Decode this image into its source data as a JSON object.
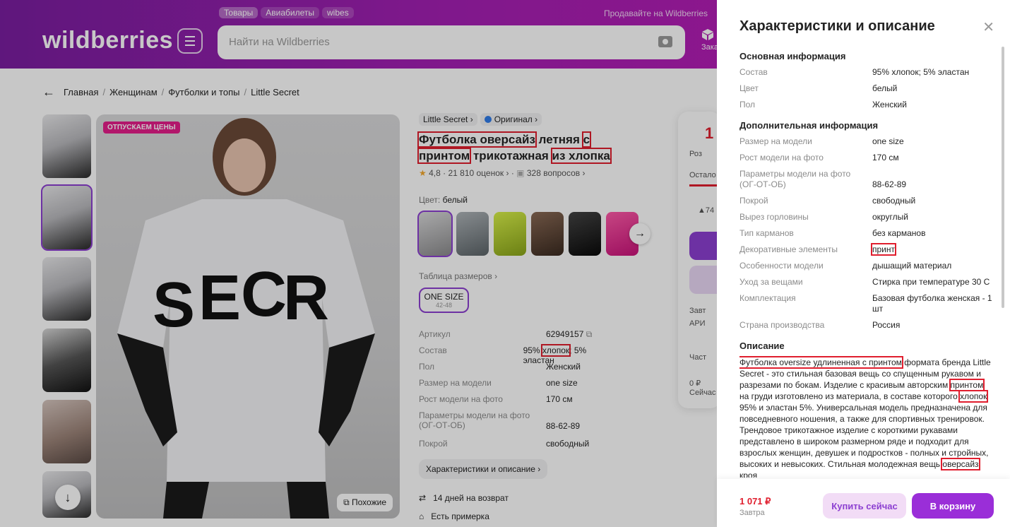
{
  "header": {
    "tabs": [
      "Товары",
      "Авиабилеты",
      "wibes"
    ],
    "sell_link": "Продавайте на Wildberries",
    "logo": "wildberries",
    "search_placeholder": "Найти на Wildberries",
    "orders_short": "Заказ"
  },
  "breadcrumbs": [
    "Главная",
    "Женщинам",
    "Футболки и топы",
    "Little Secret"
  ],
  "gallery": {
    "badge": "ОТПУСКАЕМ ЦЕНЫ",
    "similar": "Похожие"
  },
  "product": {
    "brand": "Little Secret",
    "original": "Оригинал",
    "title_parts": [
      "Футболка оверсайз",
      " летняя ",
      "с принтом",
      " трикотажная ",
      "из хлопка"
    ],
    "rating": "4,8",
    "reviews": "21 810 оценок",
    "questions": "328 вопросов",
    "color_label": "Цвет:",
    "color_value": "белый",
    "size_table": "Таблица размеров",
    "size_label": "ONE SIZE",
    "size_range": "42-48",
    "specs": [
      {
        "k": "Артикул",
        "v": "62949157"
      },
      {
        "k": "Состав",
        "v_parts": [
          "95% ",
          "хлопок",
          "; 5% эластан"
        ]
      },
      {
        "k": "Пол",
        "v": "Женский"
      },
      {
        "k": "Размер на модели",
        "v": "one size"
      },
      {
        "k": "Рост модели на фото",
        "v": "170 см"
      },
      {
        "k": "Параметры модели на фото (ОГ-ОТ-ОБ)",
        "v": "88-62-89"
      },
      {
        "k": "Покрой",
        "v": "свободный"
      }
    ],
    "char_button": "Характеристики и описание",
    "return": "14 дней на возврат",
    "fitting": "Есть примерка"
  },
  "buycard": {
    "price_partial": "1",
    "stock_partial": "Остало",
    "tag_partial": "Роз",
    "qty_partial": "▲74",
    "delivery_partial": "Завт",
    "ari_partial": "АРИ",
    "part_partial": "Част",
    "zero": "0 ₽",
    "now": "Сейчас"
  },
  "panel": {
    "title": "Характеристики и описание",
    "sections": [
      {
        "title": "Основная информация",
        "rows": [
          {
            "k": "Состав",
            "v": "95% хлопок; 5% эластан"
          },
          {
            "k": "Цвет",
            "v": "белый"
          },
          {
            "k": "Пол",
            "v": "Женский"
          }
        ]
      },
      {
        "title": "Дополнительная информация",
        "rows": [
          {
            "k": "Размер на модели",
            "v": "one size"
          },
          {
            "k": "Рост модели на фото",
            "v": "170 см"
          },
          {
            "k": "Параметры модели на фото (ОГ-ОТ-ОБ)",
            "v": "88-62-89"
          },
          {
            "k": "Покрой",
            "v": "свободный"
          },
          {
            "k": "Вырез горловины",
            "v": "округлый"
          },
          {
            "k": "Тип карманов",
            "v": "без карманов"
          },
          {
            "k": "Декоративные элементы",
            "v": "принт"
          },
          {
            "k": "Особенности модели",
            "v": "дышащий материал"
          },
          {
            "k": "Уход за вещами",
            "v": "Стирка при температуре 30 С"
          },
          {
            "k": "Комплектация",
            "v": "Базовая футболка женская - 1 шт"
          },
          {
            "k": "Страна производства",
            "v": "Россия"
          }
        ]
      }
    ],
    "desc_title": "Описание",
    "desc_parts": [
      "Футболка oversize удлиненная с принтом",
      " формата бренда Little Secret - это стильная базовая вещь со спущенным рукавом и разрезами по бокам. Изделие с красивым авторским ",
      "принтом",
      " на груди изготовлено из материала, в составе которого ",
      "хлопок",
      " 95% и эластан 5%. Универсальная модель предназначена для повседневного ношения, а также для спортивных тренировок. Трендовое трикотажное изделие с короткими рукавами представлено в широком размерном ряде и подходит для взрослых женщин, девушек и подростков - полных и стройных, высоких и невысоких. Стильная молодежная вещь ",
      "оверсайз",
      " кроя"
    ],
    "footer_price": "1 071 ₽",
    "footer_date": "Завтра",
    "buy_now": "Купить сейчас",
    "to_cart": "В корзину"
  }
}
